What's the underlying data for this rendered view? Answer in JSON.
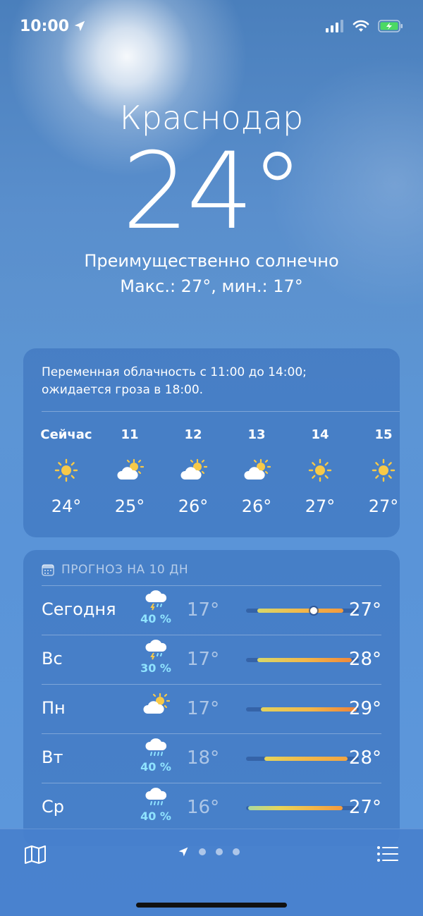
{
  "status": {
    "time": "10:00"
  },
  "header": {
    "city": "Краснодар",
    "temp": "24°",
    "condition": "Преимущественно солнечно",
    "hilo": "Макс.: 27°, мин.: 17°"
  },
  "hourly": {
    "summary_line1": "Переменная облачность с 11:00 до 14:00;",
    "summary_line2": "ожидается гроза в 18:00.",
    "hours": [
      {
        "label": "Сейчас",
        "icon": "sun-icon",
        "temp": "24°"
      },
      {
        "label": "11",
        "icon": "partly-cloudy-icon",
        "temp": "25°"
      },
      {
        "label": "12",
        "icon": "partly-cloudy-icon",
        "temp": "26°"
      },
      {
        "label": "13",
        "icon": "partly-cloudy-icon",
        "temp": "26°"
      },
      {
        "label": "14",
        "icon": "sun-icon",
        "temp": "27°"
      },
      {
        "label": "15",
        "icon": "sun-icon",
        "temp": "27°"
      }
    ]
  },
  "daily": {
    "title": "ПРОГНОЗ НА 10 ДН",
    "days": [
      {
        "day": "Сегодня",
        "icon": "thunderstorm-icon",
        "pct": "40 %",
        "lo": "17°",
        "hi": "27°",
        "from": 0.1,
        "to": 0.86,
        "current": 0.6,
        "grad": "linear-gradient(90deg,#d8d86a,#f2b84a,#f39a3e)"
      },
      {
        "day": "Вс",
        "icon": "thunderstorm-icon",
        "pct": "30 %",
        "lo": "17°",
        "hi": "28°",
        "from": 0.1,
        "to": 0.94,
        "grad": "linear-gradient(90deg,#d8d86a,#f2b84a,#f0893a)"
      },
      {
        "day": "Пн",
        "icon": "partly-cloudy-icon",
        "pct": "",
        "lo": "17°",
        "hi": "29°",
        "from": 0.13,
        "to": 0.98,
        "grad": "linear-gradient(90deg,#e3d25c,#f2b84a,#ee8238)"
      },
      {
        "day": "Вт",
        "icon": "rain-icon",
        "pct": "40 %",
        "lo": "18°",
        "hi": "28°",
        "from": 0.16,
        "to": 0.9,
        "grad": "linear-gradient(90deg,#e6d55a,#f2b84a,#f2a542)"
      },
      {
        "day": "Ср",
        "icon": "rain-icon",
        "pct": "40 %",
        "lo": "16°",
        "hi": "27°",
        "from": 0.02,
        "to": 0.86,
        "grad": "linear-gradient(90deg,#a9d9a1,#e6d55a,#f2b84a,#f39a3e)"
      }
    ]
  },
  "colors": {
    "sun": "#f7c948",
    "accent_pct": "#8fe3ff"
  }
}
